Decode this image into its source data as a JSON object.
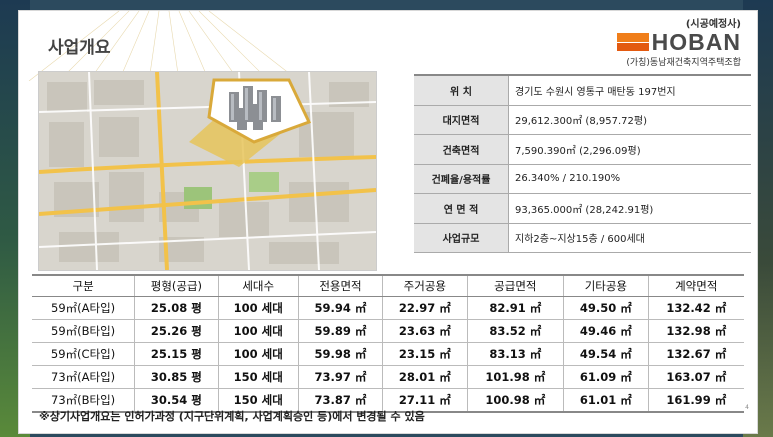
{
  "slide": {
    "title": "사업개요",
    "page_mark": "4"
  },
  "logo": {
    "top_label": "(시공예정사)",
    "wordmark": "HOBAN",
    "union": "(가칭)동남재건축지역주택조합",
    "colors": {
      "top": "#f07e1a",
      "bottom": "#e35a10"
    }
  },
  "info": [
    {
      "label": "위      치",
      "value": "경기도 수원시 영통구 매탄동 197번지"
    },
    {
      "label": "대지면적",
      "value": "29,612.300㎡ (8,957.72평)"
    },
    {
      "label": "건축면적",
      "value": "7,590.390㎡ (2,296.09평)"
    },
    {
      "label": "건폐율/용적률",
      "value": "26.340% / 210.190%"
    },
    {
      "label": "연 면 적",
      "value": "93,365.000㎡ (28,242.91평)"
    },
    {
      "label": "사업규모",
      "value": "지하2층~지상15층 / 600세대"
    }
  ],
  "spec": {
    "headers": [
      "구분",
      "평형(공급)",
      "세대수",
      "전용면적",
      "주거공용",
      "공급면적",
      "기타공용",
      "계약면적"
    ],
    "rows": [
      [
        "59㎡(A타입)",
        "25.08 평",
        "100 세대",
        "59.94 ㎡",
        "22.97 ㎡",
        "82.91 ㎡",
        "49.50 ㎡",
        "132.42 ㎡"
      ],
      [
        "59㎡(B타입)",
        "25.26 평",
        "100 세대",
        "59.89 ㎡",
        "23.63 ㎡",
        "83.52 ㎡",
        "49.46 ㎡",
        "132.98 ㎡"
      ],
      [
        "59㎡(C타입)",
        "25.15 평",
        "100 세대",
        "59.98 ㎡",
        "23.15 ㎡",
        "83.13 ㎡",
        "49.54 ㎡",
        "132.67 ㎡"
      ],
      [
        "73㎡(A타입)",
        "30.85 평",
        "150 세대",
        "73.97 ㎡",
        "28.01 ㎡",
        "101.98 ㎡",
        "61.09 ㎡",
        "163.07 ㎡"
      ],
      [
        "73㎡(B타입)",
        "30.54 평",
        "150 세대",
        "73.87 ㎡",
        "27.11 ㎡",
        "100.98 ㎡",
        "61.01 ㎡",
        "161.99 ㎡"
      ]
    ]
  },
  "note": "※상기사업개요는 인허가과정 (지구단위계획, 사업계획승인 등)에서 변경될 수 있음"
}
